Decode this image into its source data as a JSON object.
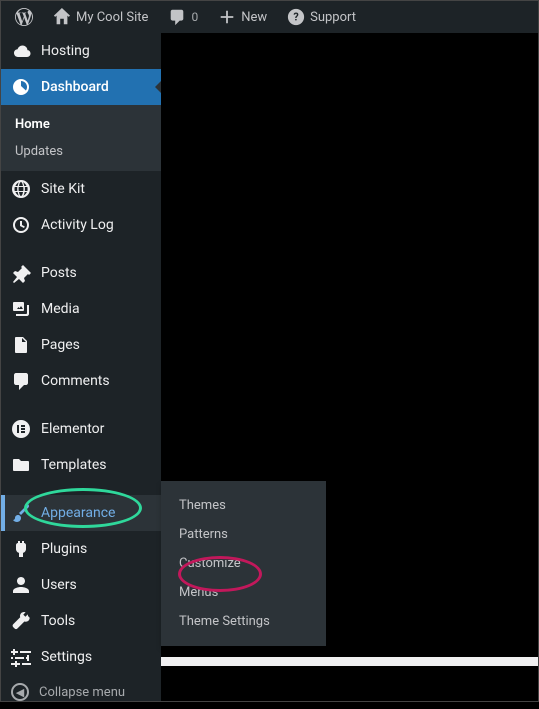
{
  "adminbar": {
    "site_title": "My Cool Site",
    "comments_count": "0",
    "new_label": "New",
    "support_label": "Support"
  },
  "sidebar": {
    "hosting": "Hosting",
    "dashboard": "Dashboard",
    "dashboard_sub": {
      "home": "Home",
      "updates": "Updates"
    },
    "sitekit": "Site Kit",
    "activitylog": "Activity Log",
    "posts": "Posts",
    "media": "Media",
    "pages": "Pages",
    "comments": "Comments",
    "elementor": "Elementor",
    "templates": "Templates",
    "appearance": "Appearance",
    "plugins": "Plugins",
    "users": "Users",
    "tools": "Tools",
    "settings": "Settings",
    "collapse": "Collapse menu"
  },
  "flyout": {
    "themes": "Themes",
    "patterns": "Patterns",
    "customize": "Customize",
    "menus": "Menus",
    "theme_settings": "Theme Settings"
  }
}
